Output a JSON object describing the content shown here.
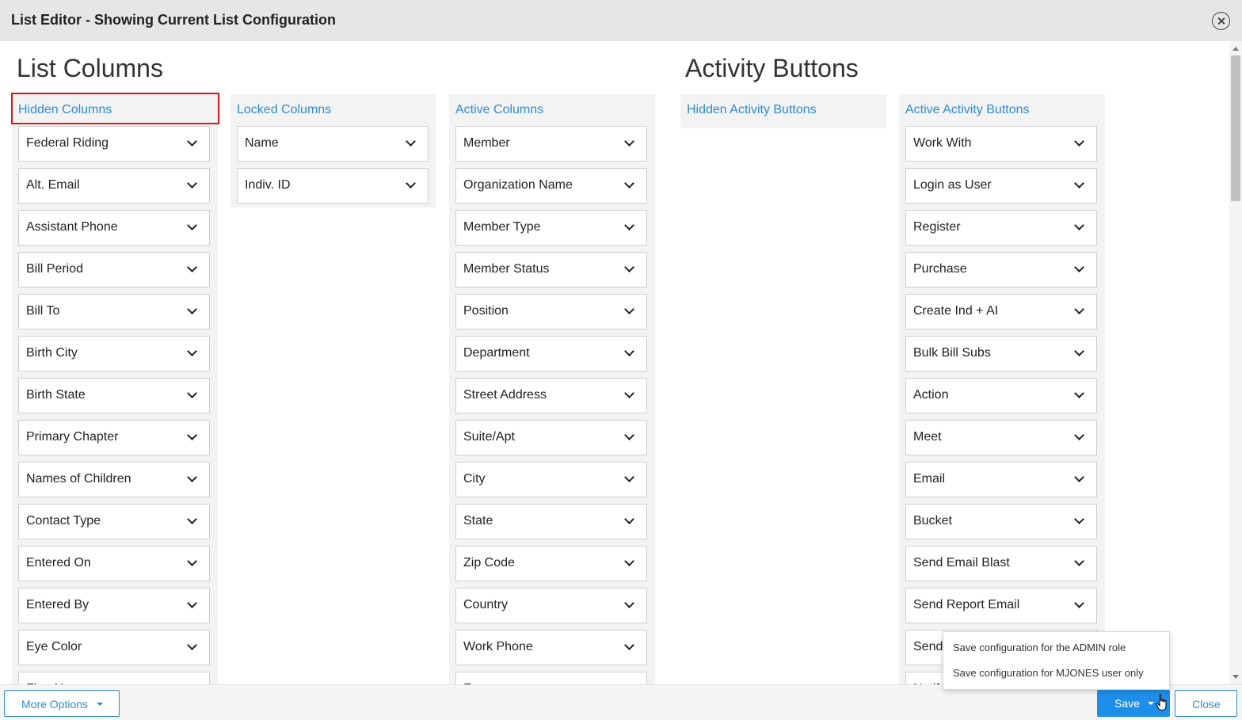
{
  "window": {
    "title": "List Editor - Showing Current List Configuration"
  },
  "sections": {
    "list_columns": "List Columns",
    "activity_buttons": "Activity Buttons"
  },
  "panels": {
    "hidden_columns": {
      "label": "Hidden Columns",
      "items": [
        "Federal Riding",
        "Alt. Email",
        "Assistant Phone",
        "Bill Period",
        "Bill To",
        "Birth City",
        "Birth State",
        "Primary Chapter",
        "Names of Children",
        "Contact Type",
        "Entered On",
        "Entered By",
        "Eye Color",
        "First Name"
      ]
    },
    "locked_columns": {
      "label": "Locked Columns",
      "items": [
        "Name",
        "Indiv. ID"
      ]
    },
    "active_columns": {
      "label": "Active Columns",
      "items": [
        "Member",
        "Organization Name",
        "Member Type",
        "Member Status",
        "Position",
        "Department",
        "Street Address",
        "Suite/Apt",
        "City",
        "State",
        "Zip Code",
        "Country",
        "Work Phone",
        "Fax"
      ]
    },
    "hidden_activity_buttons": {
      "label": "Hidden Activity Buttons",
      "items": []
    },
    "active_activity_buttons": {
      "label": "Active Activity Buttons",
      "items": [
        "Work With",
        "Login as User",
        "Register",
        "Purchase",
        "Create Ind + AI",
        "Bulk Bill Subs",
        "Action",
        "Meet",
        "Email",
        "Bucket",
        "Send Email Blast",
        "Send Report Email",
        "Send",
        "Notify"
      ]
    }
  },
  "footer": {
    "more_options": "More Options",
    "save": "Save",
    "close": "Close"
  },
  "save_menu": {
    "items": [
      "Save configuration for the ADMIN role",
      "Save configuration for MJONES user only"
    ]
  },
  "icons": {
    "close": "close-circle-icon",
    "chevron": "chevron-down-icon",
    "caret": "caret-down-icon",
    "cursor": "hand-pointer-icon"
  },
  "colors": {
    "accent": "#2e8bd0",
    "primary_button": "#1e8fe8",
    "highlight": "#e01414",
    "title_bar": "#e6e6e6"
  }
}
